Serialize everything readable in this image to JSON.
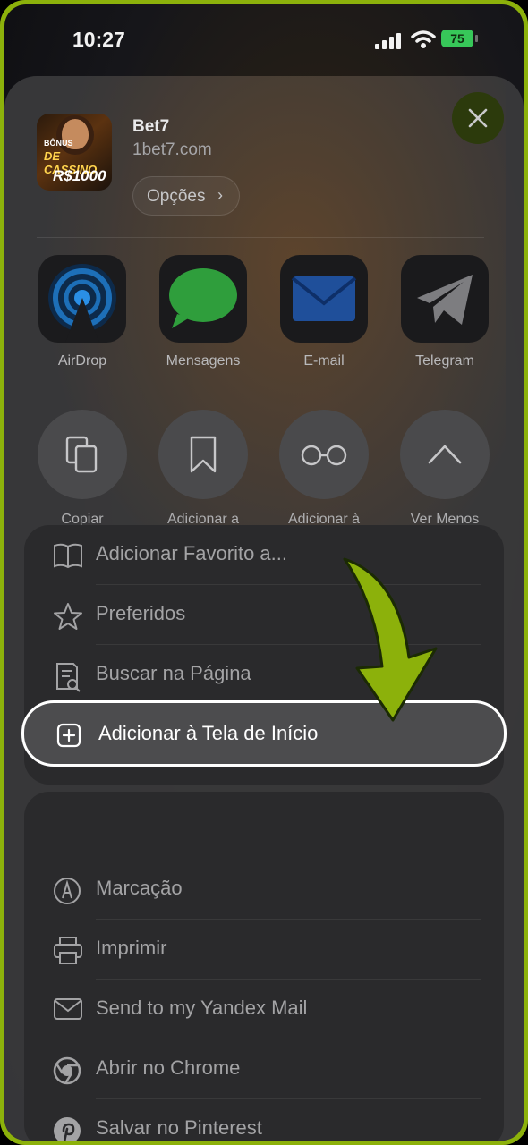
{
  "status_bar": {
    "time": "10:27",
    "battery": "75"
  },
  "site": {
    "title": "Bet7",
    "url": "1bet7.com",
    "options_label": "Opções"
  },
  "thumbnail": {
    "line1": "BÔNUS",
    "line2": "DE CASSINO",
    "line3": "R$1000"
  },
  "apps": [
    {
      "label": "AirDrop",
      "icon": "airdrop-icon"
    },
    {
      "label": "Mensagens",
      "icon": "messages-icon"
    },
    {
      "label": "E-mail",
      "icon": "mail-icon"
    },
    {
      "label": "Telegram",
      "icon": "telegram-icon"
    }
  ],
  "actions": [
    {
      "label": "Copiar",
      "icon": "copy-icon"
    },
    {
      "label": "Adicionar a Favoritos",
      "icon": "bookmark-icon"
    },
    {
      "label": "Adicionar à Lista de Leitura",
      "icon": "glasses-icon"
    },
    {
      "label": "Ver Menos",
      "icon": "chevron-up-icon"
    }
  ],
  "menu_group1": [
    {
      "label": "Adicionar Favorito a...",
      "icon": "book-icon"
    },
    {
      "label": "Preferidos",
      "icon": "star-icon"
    },
    {
      "label": "Buscar na Página",
      "icon": "find-page-icon"
    }
  ],
  "highlighted_item": {
    "label": "Adicionar à Tela de Início",
    "icon": "plus-square-icon"
  },
  "menu_group2": [
    {
      "label": "Marcação",
      "icon": "markup-icon"
    },
    {
      "label": "Imprimir",
      "icon": "printer-icon"
    },
    {
      "label": "Send to my Yandex Mail",
      "icon": "envelope-icon"
    },
    {
      "label": "Abrir no Chrome",
      "icon": "chrome-icon"
    },
    {
      "label": "Salvar no Pinterest",
      "icon": "pinterest-icon"
    }
  ],
  "colors": {
    "frame": "#8cb10b",
    "arrow": "#8cb10b",
    "sheet": "#3a3a3c"
  }
}
